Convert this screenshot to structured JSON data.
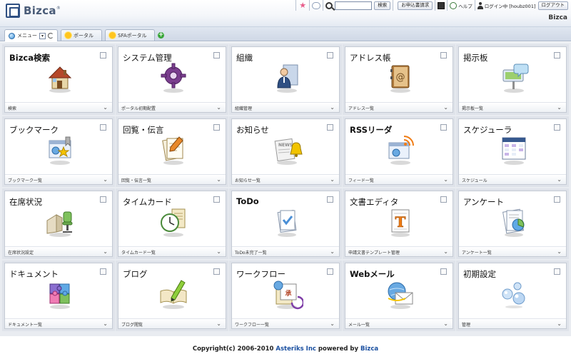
{
  "header": {
    "logo_text": "Bizca",
    "brand_right": "Bizca",
    "search_placeholder": "",
    "search_button": "検索",
    "apply_button": "お申込書請求",
    "help_label": "ヘルプ",
    "login_label": "ログイン中 [houbz001]",
    "logout_button": "ログアウト"
  },
  "tabs": [
    {
      "label": "メニュー",
      "icon": "globe-icon",
      "active": true
    },
    {
      "label": "ポータル",
      "icon": "sun-icon",
      "active": false
    },
    {
      "label": "SFAポータル",
      "icon": "sun-icon",
      "active": false
    }
  ],
  "cards": [
    {
      "title": "Bizca検索",
      "footer": "検索",
      "icon": "house-icon"
    },
    {
      "title": "システム管理",
      "footer": "ポータル初期配置",
      "icon": "gear-icon"
    },
    {
      "title": "組織",
      "footer": "組織管理",
      "icon": "person-icon"
    },
    {
      "title": "アドレス帳",
      "footer": "アドレス一覧",
      "icon": "address-book-icon"
    },
    {
      "title": "掲示板",
      "footer": "掲示板一覧",
      "icon": "bulletin-board-icon"
    },
    {
      "title": "ブックマーク",
      "footer": "ブックマーク一覧",
      "icon": "bookmark-icon"
    },
    {
      "title": "回覧・伝言",
      "footer": "回覧・伝言一覧",
      "icon": "memo-icon"
    },
    {
      "title": "お知らせ",
      "footer": "お知らせ一覧",
      "icon": "news-bell-icon"
    },
    {
      "title": "RSSリーダ",
      "footer": "フィード一覧",
      "icon": "rss-icon"
    },
    {
      "title": "スケジューラ",
      "footer": "スケジュール",
      "icon": "calendar-icon"
    },
    {
      "title": "在席状況",
      "footer": "在席状況設定",
      "icon": "desk-chair-icon"
    },
    {
      "title": "タイムカード",
      "footer": "タイムカード一覧",
      "icon": "clock-icon"
    },
    {
      "title": "ToDo",
      "footer": "ToDo未完了一覧",
      "icon": "todo-check-icon"
    },
    {
      "title": "文書エディタ",
      "footer": "申請文書テンプレート管理",
      "icon": "document-t-icon"
    },
    {
      "title": "アンケート",
      "footer": "アンケート一覧",
      "icon": "survey-chart-icon"
    },
    {
      "title": "ドキュメント",
      "footer": "ドキュメント一覧",
      "icon": "puzzle-icon"
    },
    {
      "title": "ブログ",
      "footer": "ブログ閲覧",
      "icon": "book-pencil-icon"
    },
    {
      "title": "ワークフロー",
      "footer": "ワークフロー一覧",
      "icon": "workflow-icon"
    },
    {
      "title": "Webメール",
      "footer": "メール一覧",
      "icon": "mail-globe-icon"
    },
    {
      "title": "初期設定",
      "footer": "管理",
      "icon": "bubbles-icon"
    }
  ],
  "footer": {
    "copyright_prefix": "Copyright(c) 2006-2010",
    "company": "Asteriks Inc",
    "powered_by": "powered by",
    "product": "Bizca"
  },
  "colors": {
    "accent": "#2e4f82",
    "tab_bar": "#d5dde9",
    "grid_bg": "#e9ecf1",
    "link": "#1a4fa0"
  }
}
